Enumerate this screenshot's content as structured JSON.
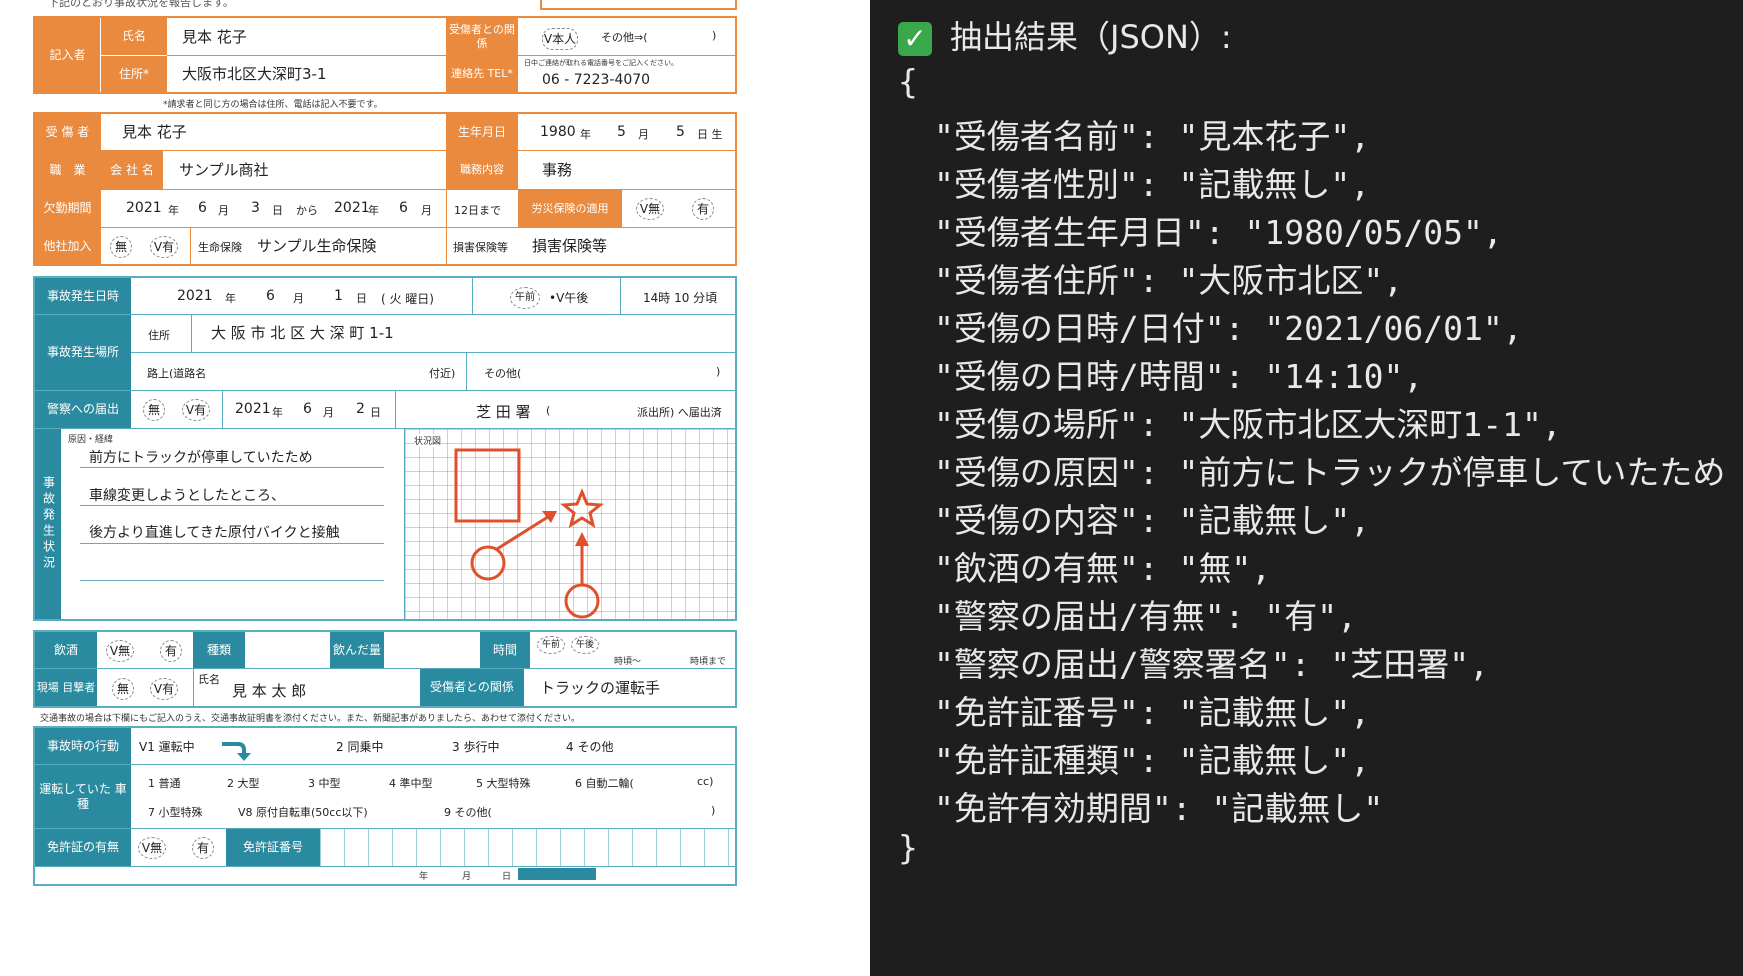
{
  "form": {
    "top_note": "下記のとおり事故状況を報告します。",
    "writer": {
      "section": "記入者",
      "name_label": "氏名",
      "name": "見本 花子",
      "address_label": "住所*",
      "address": "大阪市北区大深町3-1",
      "relation_label": "受傷者との関係",
      "relation_self": "V本人",
      "relation_other": "その他⇒(",
      "relation_close": ")",
      "contact_label": "連絡先 TEL*",
      "contact_note": "日中ご連絡が取れる電話番号をご記入ください。",
      "tel": "06 - 7223-4070",
      "footnote": "*請求者と同じ方の場合は住所、電話は記入不要です。"
    },
    "injured": {
      "label": "受 傷 者",
      "name": "見本 花子",
      "dob_label": "生年月日",
      "dob_year": "1980",
      "dob_month": "5",
      "dob_day": "5",
      "year_unit": "年",
      "month_unit": "月",
      "day_born": "日 生",
      "job_label": "職　業",
      "company_label": "会 社 名",
      "company": "サンプル商社",
      "duty_label": "職務内容",
      "duty": "事務",
      "absence_label": "欠勤期間",
      "abs_y1": "2021",
      "abs_m1": "6",
      "abs_d1": "3",
      "day_unit": "日",
      "from": "から",
      "abs_y2": "2021",
      "abs_m2": "6",
      "abs_until": "12日まで",
      "workers_comp_label": "労災保険の適用",
      "wc_no": "V無",
      "wc_yes": "有",
      "other_ins_label": "他社加入",
      "oi_no": "無",
      "oi_yes": "V有",
      "life_label": "生命保険",
      "life": "サンプル生命保険",
      "damage_label": "損害保険等",
      "damage": "損害保険等"
    },
    "accident": {
      "datetime_label": "事故発生日時",
      "year": "2021",
      "year_unit": "年",
      "month": "6",
      "month_unit": "月",
      "day": "1",
      "day_unit": "日",
      "weekday": "( 火 曜日)",
      "am": "午前",
      "pm": "•V午後",
      "time": "14時 10 分頃",
      "place_label": "事故発生場所",
      "address_label": "住所",
      "address": "大 阪 市 北 区 大 深 町 1-1",
      "road_label": "路上(道路名",
      "near": "付近)",
      "other": "その他(",
      "other_close": ")",
      "police_label": "警察への届出",
      "police_no": "無",
      "police_yes": "V有",
      "police_y": "2021",
      "police_m": "6",
      "police_d": "2",
      "station": "芝 田 署",
      "station_paren": "(",
      "koban": "派出所) へ届出済",
      "situation_label": "事故発生状況",
      "cause_label": "原因・経緯",
      "cause_lines": [
        "前方にトラックが停車していたため",
        "車線変更しようとしたところ、",
        "後方より直進してきた原付バイクと接触"
      ],
      "diagram_label": "状況図"
    },
    "drinking": {
      "label": "飲酒",
      "no": "V無",
      "yes": "有",
      "kind_label": "種類",
      "amount_label": "飲んだ量",
      "time_label": "時間",
      "am": "午前",
      "pm": "午後",
      "from": "時頃〜",
      "until": "時頃まで"
    },
    "witness": {
      "label": "現場 目撃者",
      "no": "無",
      "yes": "V有",
      "name_label": "氏名",
      "name": "見 本 太 郎",
      "relation_label": "受傷者との関係",
      "relation": "トラックの運転手"
    },
    "traffic_note": "交通事故の場合は下欄にもご記入のうえ、交通事故証明書を添付ください。また、新聞記事がありましたら、あわせて添付ください。",
    "traffic": {
      "action_label": "事故時の行動",
      "actions": [
        "V1 運転中",
        "2 同乗中",
        "3 歩行中",
        "4 その他"
      ],
      "vehicle_label": "運転していた 車 種",
      "vehicles_row1": [
        "1 普通",
        "2 大型",
        "3 中型",
        "4 準中型",
        "5 大型特殊",
        "6 自動二輪(",
        "cc)"
      ],
      "vehicles_row2": [
        "7 小型特殊",
        "V8 原付自転車(50cc以下)",
        "9 その他(",
        ")"
      ],
      "license_label": "免許証の有無",
      "lic_no": "V無",
      "lic_yes": "有",
      "license_no_label": "免許証番号",
      "bottom_year": "年",
      "bottom_month": "月",
      "bottom_day": "日"
    }
  },
  "output": {
    "heading": "抽出結果（JSON）:",
    "open": "{",
    "close": "}",
    "lines": [
      "\"受傷者名前\": \"見本花子\",",
      "\"受傷者性別\": \"記載無し\",",
      "\"受傷者生年月日\": \"1980/05/05\",",
      "\"受傷者住所\": \"大阪市北区\",",
      "\"受傷の日時/日付\": \"2021/06/01\",",
      "\"受傷の日時/時間\": \"14:10\",",
      "\"受傷の場所\": \"大阪市北区大深町1-1\",",
      "\"受傷の原因\": \"前方にトラックが停車していたため",
      "\"受傷の内容\": \"記載無し\",",
      "\"飲酒の有無\": \"無\",",
      "\"警察の届出/有無\": \"有\",",
      "\"警察の届出/警察署名\": \"芝田署\",",
      "\"免許証番号\": \"記載無し\",",
      "\"免許証種類\": \"記載無し\",",
      "\"免許有効期間\": \"記載無し\""
    ]
  }
}
